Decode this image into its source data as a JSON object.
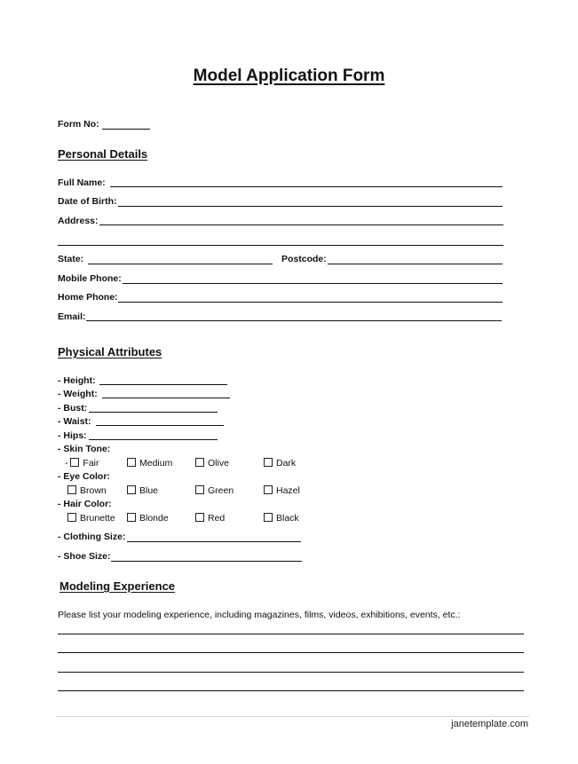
{
  "title": "Model Application  Form",
  "form_no_label": "Form No:",
  "sections": {
    "personal": "Personal Details",
    "physical": "Physical Attributes",
    "experience": "Modeling Experience"
  },
  "personal": {
    "full_name": "Full Name:",
    "dob": "Date of Birth:",
    "address": "Address:",
    "state": "State:",
    "postcode": "Postcode:",
    "mobile": "Mobile Phone:",
    "home": "Home Phone:",
    "email": "Email:"
  },
  "physical": {
    "height": "- Height:",
    "weight": "- Weight:",
    "bust": "- Bust:",
    "waist": "- Waist:",
    "hips": "- Hips:",
    "skin_tone": "- Skin Tone:",
    "skin_prefix": "-",
    "skin_options": [
      "Fair",
      "Medium",
      "Olive",
      "Dark"
    ],
    "eye_color": "- Eye Color:",
    "eye_options": [
      "Brown",
      "Blue",
      "Green",
      "Hazel"
    ],
    "hair_color": "- Hair Color:",
    "hair_options": [
      "Brunette",
      "Blonde",
      "Red",
      "Black"
    ],
    "clothing_size": "- Clothing Size:",
    "shoe_size": "- Shoe Size:"
  },
  "experience": {
    "prompt": "Please list your modeling experience, including magazines, films, videos, exhibitions, events, etc.:"
  },
  "footer": "janetemplate.com"
}
